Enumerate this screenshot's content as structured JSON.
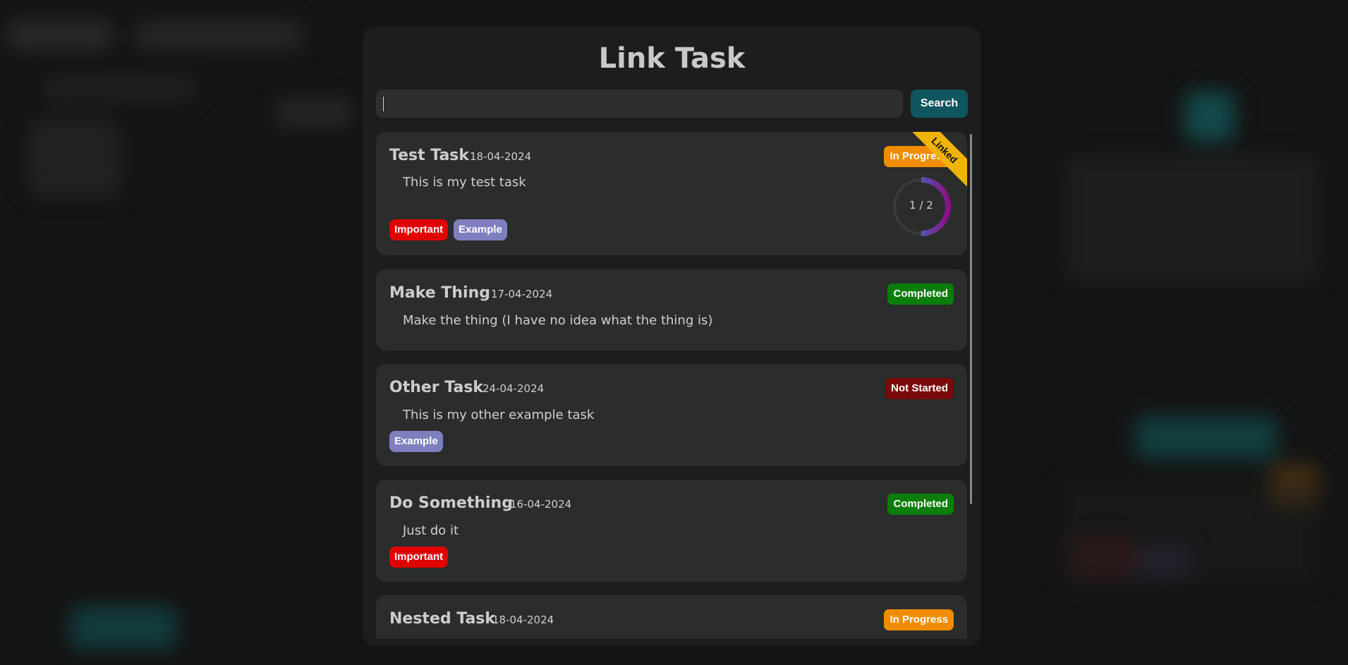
{
  "modal": {
    "title": "Link Task",
    "search": {
      "value": "",
      "placeholder": "",
      "button_label": "Search"
    }
  },
  "tasks": [
    {
      "title": "Test Task",
      "date": "18-04-2024",
      "description": "This is my test task",
      "status": "In Progress",
      "status_color": "#f08c00",
      "tags": [
        {
          "label": "Important",
          "color": "#e00000"
        },
        {
          "label": "Example",
          "color": "#7f7fc0"
        }
      ],
      "ribbon": "Linked",
      "progress": {
        "done": 1,
        "total": 2,
        "label": "1 / 2"
      }
    },
    {
      "title": "Make Thing",
      "date": "17-04-2024",
      "description": "Make the thing (I have no idea what the thing is)",
      "status": "Completed",
      "status_color": "#0a7d0a",
      "tags": []
    },
    {
      "title": "Other Task",
      "date": "24-04-2024",
      "description": "This is my other example task",
      "status": "Not Started",
      "status_color": "#7a0909",
      "tags": [
        {
          "label": "Example",
          "color": "#7f7fc0"
        }
      ]
    },
    {
      "title": "Do Something",
      "date": "16-04-2024",
      "description": "Just do it",
      "status": "Completed",
      "status_color": "#0a7d0a",
      "tags": [
        {
          "label": "Important",
          "color": "#e00000"
        }
      ]
    },
    {
      "title": "Nested Task",
      "date": "18-04-2024",
      "description": "",
      "status": "In Progress",
      "status_color": "#f08c00",
      "tags": []
    }
  ]
}
